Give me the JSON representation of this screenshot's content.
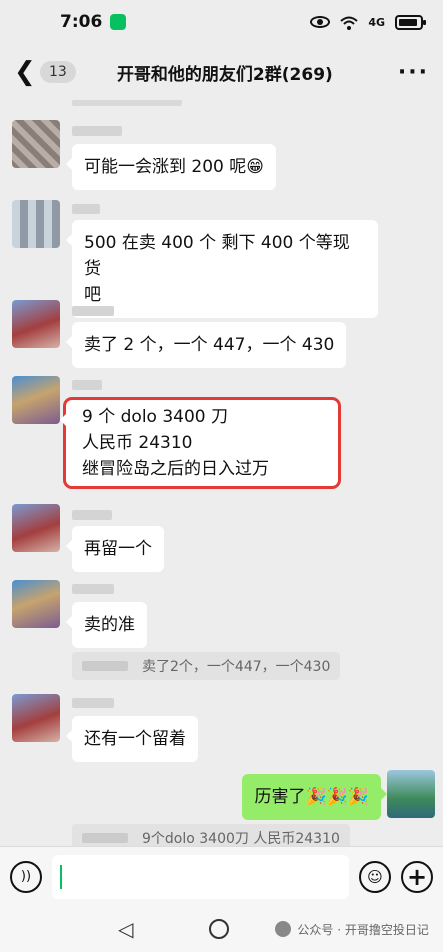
{
  "status": {
    "time": "7:06",
    "network": "4G"
  },
  "header": {
    "back_count": "13",
    "title": "开哥和他的朋友们2群(269)",
    "more": "···"
  },
  "messages": [
    {
      "text": "可能一会涨到 200 呢😁"
    },
    {
      "text": "500 在卖 400 个 剩下 400 个等现货\n吧"
    },
    {
      "text": "卖了 2 个，一个 447，一个 430"
    },
    {
      "text": "9 个 dolo 3400 刀\n人民币 24310\n继冒险岛之后的日入过万"
    },
    {
      "text": "再留一个"
    },
    {
      "text": "卖的准"
    },
    {
      "text": "还有一个留着"
    }
  ],
  "quotes": [
    {
      "text": "卖了2个，一个447，一个430"
    },
    {
      "text": "9个dolo 3400刀 人民币24310"
    }
  ],
  "self_message": {
    "text": "历害了🎉🎉🎉"
  },
  "input": {
    "placeholder": ""
  },
  "watermark": {
    "text": "公众号 · 开哥撸空投日记"
  }
}
